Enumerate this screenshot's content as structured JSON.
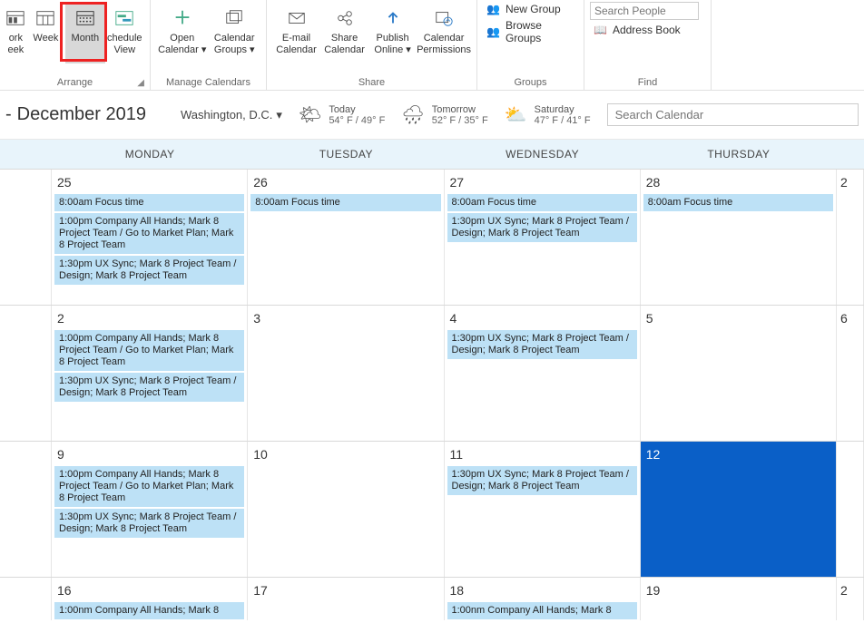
{
  "ribbon": {
    "arrange": {
      "label": "Arrange",
      "work_week": "ork eek",
      "week": "Week",
      "month": "Month",
      "schedule_view": "chedule View"
    },
    "manage": {
      "label": "Manage Calendars",
      "open_calendar": "Open Calendar",
      "calendar_groups": "Calendar Groups"
    },
    "share": {
      "label": "Share",
      "email": "E-mail Calendar",
      "share_cal": "Share Calendar",
      "publish": "Publish Online",
      "permissions": "Calendar Permissions"
    },
    "groups": {
      "label": "Groups",
      "new_group": "New Group",
      "browse": "Browse Groups"
    },
    "find": {
      "label": "Find",
      "search_placeholder": "Search People",
      "address_book": "Address Book"
    }
  },
  "header": {
    "title_prefix": "-",
    "title": "December 2019",
    "location": "Washington,  D.C.",
    "weather": [
      {
        "icon": "🌤",
        "label": "Today",
        "temps": "54° F / 49° F"
      },
      {
        "icon": "🌧",
        "label": "Tomorrow",
        "temps": "52° F / 35° F"
      },
      {
        "icon": "⛅",
        "label": "Saturday",
        "temps": "47° F / 41° F"
      }
    ],
    "search_placeholder": "Search Calendar"
  },
  "weekdays": [
    "MONDAY",
    "TUESDAY",
    "WEDNESDAY",
    "THURSDAY"
  ],
  "events": {
    "focus": "8:00am Focus time",
    "allhands": "1:00pm Company All Hands; Mark 8 Project Team / Go to Market Plan; Mark 8 Project Team",
    "ux": "1:30pm UX Sync; Mark 8 Project Team / Design; Mark 8 Project Team",
    "allhands_cut": "1:00nm Company All Hands; Mark 8"
  },
  "grid": [
    {
      "days": [
        {
          "num": "25",
          "events": [
            "focus",
            "allhands",
            "ux"
          ]
        },
        {
          "num": "26",
          "events": [
            "focus"
          ]
        },
        {
          "num": "27",
          "events": [
            "focus",
            "ux"
          ]
        },
        {
          "num": "28",
          "events": [
            "focus"
          ]
        }
      ],
      "trail": "2"
    },
    {
      "days": [
        {
          "num": "2",
          "events": [
            "allhands",
            "ux"
          ]
        },
        {
          "num": "3",
          "events": []
        },
        {
          "num": "4",
          "events": [
            "ux"
          ]
        },
        {
          "num": "5",
          "events": []
        }
      ],
      "trail": "6"
    },
    {
      "days": [
        {
          "num": "9",
          "events": [
            "allhands",
            "ux"
          ]
        },
        {
          "num": "10",
          "events": []
        },
        {
          "num": "11",
          "events": [
            "ux"
          ]
        },
        {
          "num": "12",
          "events": [],
          "today": true
        }
      ],
      "trail": ""
    },
    {
      "short": true,
      "days": [
        {
          "num": "16",
          "events": [
            "allhands_cut"
          ]
        },
        {
          "num": "17",
          "events": []
        },
        {
          "num": "18",
          "events": [
            "allhands_cut"
          ],
          "cut": true
        },
        {
          "num": "19",
          "events": []
        }
      ],
      "trail": "2"
    }
  ]
}
